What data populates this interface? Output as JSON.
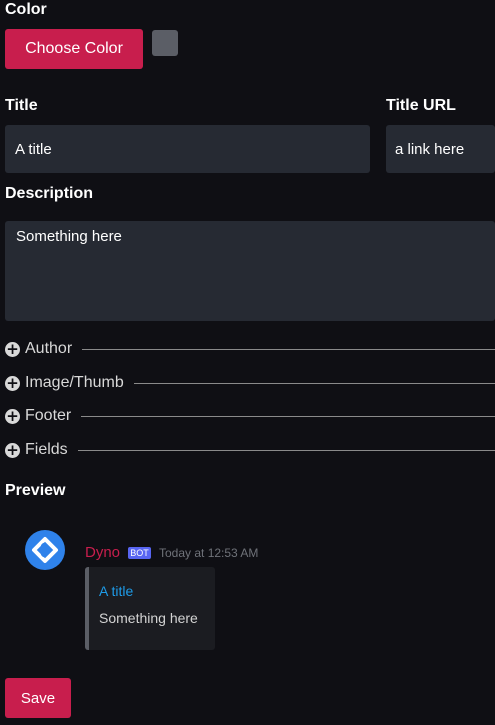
{
  "color": {
    "label": "Color",
    "button_label": "Choose Color",
    "swatch_color": "#5b5e66"
  },
  "title": {
    "label": "Title",
    "value": "A title"
  },
  "title_url": {
    "label": "Title URL",
    "value": "a link here"
  },
  "description": {
    "label": "Description",
    "value": "Something here"
  },
  "sections": [
    {
      "label": "Author",
      "icon": "plus-circle-icon"
    },
    {
      "label": "Image/Thumb",
      "icon": "plus-circle-icon"
    },
    {
      "label": "Footer",
      "icon": "plus-circle-icon"
    },
    {
      "label": "Fields",
      "icon": "plus-circle-icon"
    }
  ],
  "preview": {
    "label": "Preview",
    "bot_name": "Dyno",
    "bot_tag": "BOT",
    "timestamp": "Today at 12:53 AM",
    "embed_title": "A title",
    "embed_description": "Something here",
    "avatar_icon": "dyno-logo-icon"
  },
  "actions": {
    "save_label": "Save"
  },
  "colors": {
    "accent": "#c81e4d",
    "background": "#0f0f14",
    "input_background": "#262a33",
    "link": "#1e9be8",
    "avatar": "#2f82ea"
  }
}
